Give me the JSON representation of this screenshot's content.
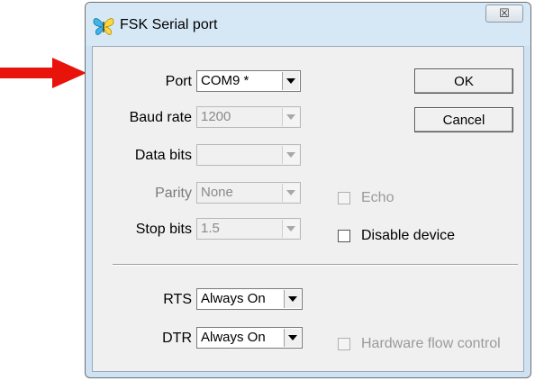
{
  "window": {
    "title": "FSK Serial port",
    "close_glyph": "☒"
  },
  "form": {
    "port": {
      "label": "Port",
      "value": "COM9 *"
    },
    "baud_rate": {
      "label": "Baud rate",
      "value": "1200"
    },
    "data_bits": {
      "label": "Data bits",
      "value": ""
    },
    "parity": {
      "label": "Parity",
      "value": "None"
    },
    "stop_bits": {
      "label": "Stop bits",
      "value": "1.5"
    },
    "rts": {
      "label": "RTS",
      "value": "Always On"
    },
    "dtr": {
      "label": "DTR",
      "value": "Always On"
    }
  },
  "buttons": {
    "ok": "OK",
    "cancel": "Cancel"
  },
  "checkboxes": {
    "echo": {
      "label": "Echo",
      "checked": false,
      "enabled": false
    },
    "disable_device": {
      "label": "Disable device",
      "checked": false,
      "enabled": true
    },
    "hardware_flow_control": {
      "label": "Hardware flow control",
      "checked": false,
      "enabled": false
    }
  },
  "colors": {
    "arrow": "#e8140c",
    "titlebar": "#d6e7f5",
    "dialog_face": "#f0f0f0"
  },
  "icons": {
    "app": "butterfly-icon",
    "pointer": "red-arrow-icon"
  }
}
